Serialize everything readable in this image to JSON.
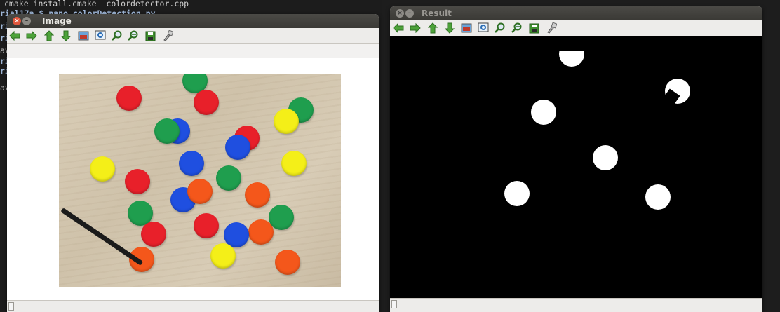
{
  "terminal": {
    "lines": [
      "cmake_install.cmake  colordetector.cpp",
      "rial17a $ nano colorDetection.py",
      "ri",
      "ri",
      "av",
      "ri",
      "ri",
      "av"
    ]
  },
  "windows": {
    "image": {
      "title": "Image"
    },
    "result": {
      "title": "Result"
    }
  },
  "toolbar": {
    "icons": [
      "arrow-left-icon",
      "arrow-right-icon",
      "arrow-up-icon",
      "arrow-down-icon",
      "image-icon",
      "zoom-fit-icon",
      "zoom-in-icon",
      "zoom-out-icon",
      "save-icon",
      "properties-icon"
    ]
  },
  "colors": {
    "red": "#e8202a",
    "green": "#1f9e4e",
    "blue": "#1f4fe0",
    "yellow": "#f4ef18",
    "orange": "#f4571b",
    "accent_close": "#e2583e"
  }
}
